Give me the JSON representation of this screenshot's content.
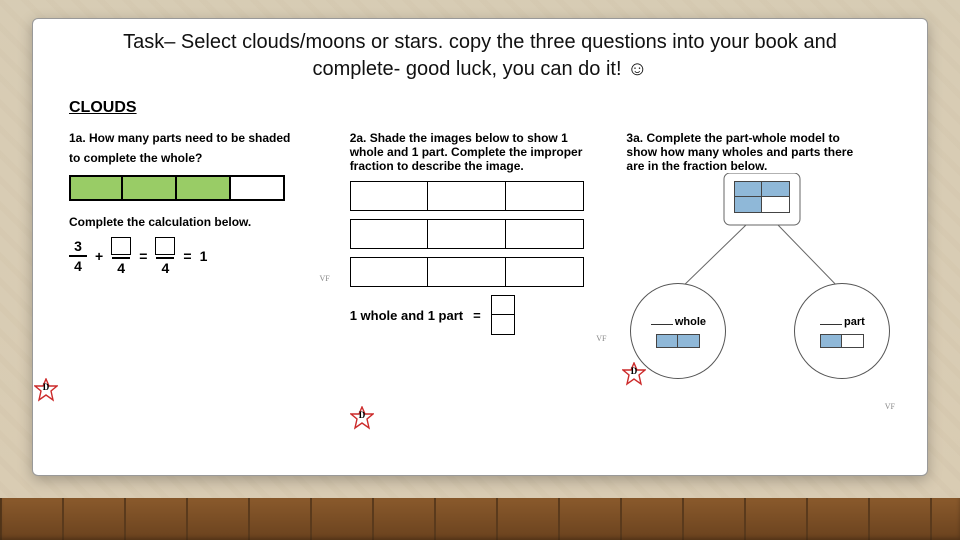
{
  "task": {
    "line1": "Task– Select clouds/moons or stars. copy the three questions into your book and",
    "line2_prefix": "complete- good luck, you can do it! ",
    "smiley": "☺"
  },
  "section_heading": "CLOUDS",
  "q1": {
    "prompt_l1": "1a. How many parts need to be shaded",
    "prompt_l2": "to complete the whole?",
    "sub_prompt": "Complete the calculation below.",
    "shaded_cells": 3,
    "total_cells": 4,
    "frac_num": "3",
    "frac_den": "4",
    "plus": "+",
    "eq": "=",
    "result": "1",
    "den2": "4",
    "den3": "4"
  },
  "q2": {
    "prompt_l1": "2a. Shade the images below to show 1",
    "prompt_l2": "whole and 1 part. Complete the improper",
    "prompt_l3": "fraction to describe the image.",
    "rows": 3,
    "cols_per_row": 3,
    "eq_label": "1 whole and 1 part",
    "eq": "="
  },
  "q3": {
    "prompt_l1": "3a. Complete the part-whole model to",
    "prompt_l2": "show how many wholes and parts there",
    "prompt_l3": "are in the fraction below.",
    "whole_label": "whole",
    "part_label": "part"
  },
  "star_letter": "D",
  "footer_mark": "VF",
  "colors": {
    "shade_green": "#99cc66",
    "shade_blue": "#8fb8d8",
    "star_fill": "#ffffff",
    "star_stroke": "#cc2a2a"
  }
}
